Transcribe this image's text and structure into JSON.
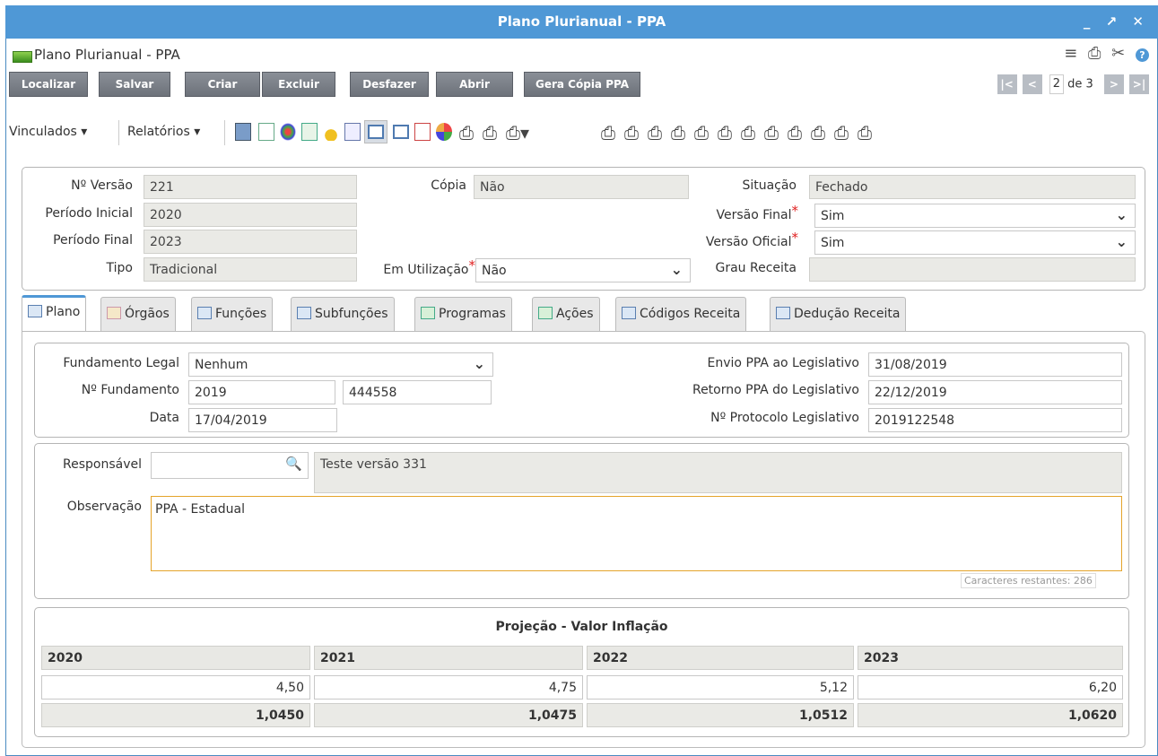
{
  "window": {
    "title": "Plano Plurianual - PPA",
    "controls": "_ ↗ ✕"
  },
  "header": {
    "title": "Plano Plurianual - PPA"
  },
  "toolbar": {
    "buttons": [
      "Localizar",
      "Salvar",
      "Criar",
      "Excluir",
      "Desfazer",
      "Abrir",
      "Gera Cópia PPA"
    ],
    "pager": {
      "first": "|<",
      "prev": "<",
      "current": "2",
      "of_label": "de 3",
      "next": ">",
      "last": ">|"
    }
  },
  "iconbar": {
    "vinculados": "Vinculados ▾",
    "relatorios": "Relatórios ▾"
  },
  "form": {
    "versao_label": "Nº Versão",
    "versao_value": "221",
    "copia_label": "Cópia",
    "copia_value": "Não",
    "situacao_label": "Situação",
    "situacao_value": "Fechado",
    "periodo_inicial_label": "Período Inicial",
    "periodo_inicial_value": "2020",
    "versao_final_label": "Versão Final",
    "versao_final_value": "Sim",
    "periodo_final_label": "Período Final",
    "periodo_final_value": "2023",
    "versao_oficial_label": "Versão Oficial",
    "versao_oficial_value": "Sim",
    "tipo_label": "Tipo",
    "tipo_value": "Tradicional",
    "em_utilizacao_label": "Em Utilização",
    "em_utilizacao_value": "Não",
    "grau_receita_label": "Grau Receita",
    "grau_receita_value": "",
    "required_mark": "*"
  },
  "tabs": [
    "Plano",
    "Órgãos",
    "Funções",
    "Subfunções",
    "Programas",
    "Ações",
    "Códigos Receita",
    "Dedução Receita"
  ],
  "plano": {
    "fundamento_legal_label": "Fundamento Legal",
    "fundamento_legal_value": "Nenhum",
    "n_fundamento_label": "Nº Fundamento",
    "n_fundamento_value1": "2019",
    "n_fundamento_value2": "444558",
    "data_label": "Data",
    "data_value": "17/04/2019",
    "envio_label": "Envio PPA ao Legislativo",
    "envio_value": "31/08/2019",
    "retorno_label": "Retorno PPA do Legislativo",
    "retorno_value": "22/12/2019",
    "protocolo_label": "Nº Protocolo Legislativo",
    "protocolo_value": "2019122548",
    "responsavel_label": "Responsável",
    "responsavel_value": "",
    "responsavel_desc": "Teste versão 331",
    "observacao_label": "Observação",
    "observacao_value": "PPA - Estadual",
    "caracteres": "Caracteres restantes: 286"
  },
  "projecao": {
    "title": "Projeção - Valor Inflação",
    "years": [
      "2020",
      "2021",
      "2022",
      "2023"
    ],
    "values": [
      "4,50",
      "4,75",
      "5,12",
      "6,20"
    ],
    "factors": [
      "1,0450",
      "1,0475",
      "1,0512",
      "1,0620"
    ]
  }
}
